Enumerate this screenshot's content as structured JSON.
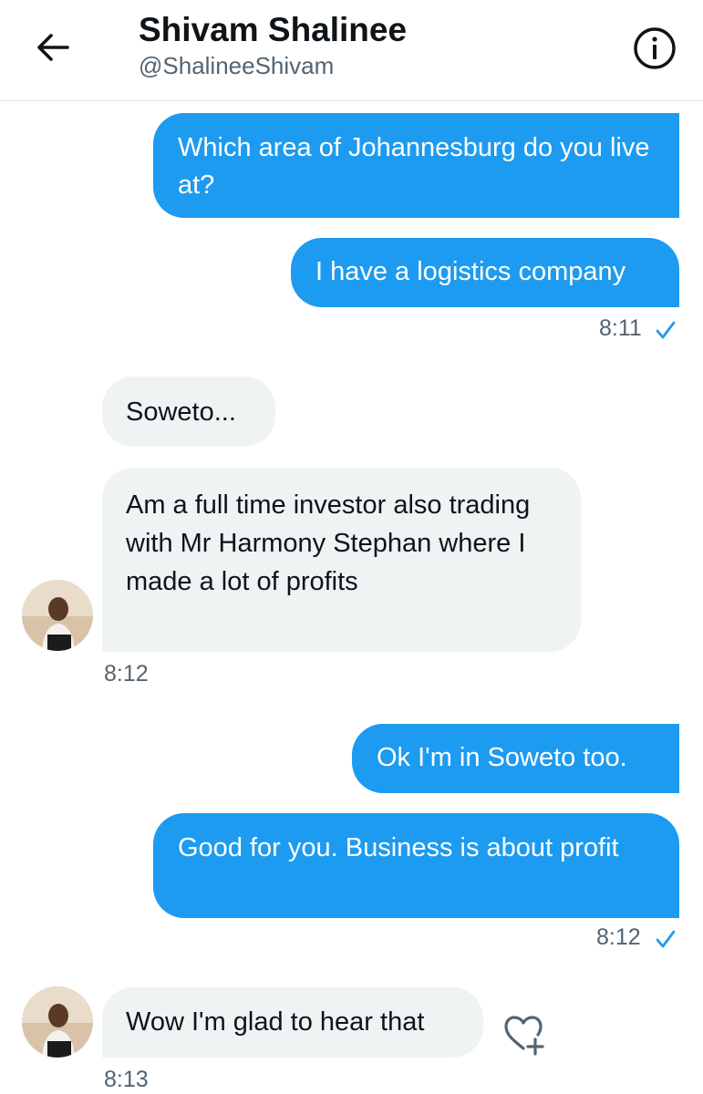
{
  "header": {
    "name": "Shivam Shalinee",
    "handle": "@ShalineeShivam",
    "back_icon": "arrow-left-icon",
    "info_icon": "info-icon"
  },
  "colors": {
    "sent": "#1d9bf0",
    "received": "#eff3f4",
    "muted": "#536471"
  },
  "messages": [
    {
      "direction": "sent",
      "text": "Which area of Johannesburg do you live at?"
    },
    {
      "direction": "sent",
      "text": "I have a logistics company",
      "time": "8:11",
      "status_icon": "checkmark-icon"
    },
    {
      "direction": "received",
      "text": "Soweto..."
    },
    {
      "direction": "received",
      "text": "Am a full time investor also trading with Mr Harmony Stephan where I made a lot of profits",
      "time": "8:12"
    },
    {
      "direction": "sent",
      "text": "Ok I'm in Soweto too."
    },
    {
      "direction": "sent",
      "text": "Good for you. Business is about profit",
      "time": "8:12",
      "status_icon": "checkmark-icon"
    },
    {
      "direction": "received",
      "text": "Wow I'm glad to hear that",
      "time": "8:13",
      "reaction_icon": "heart-plus-icon"
    }
  ]
}
